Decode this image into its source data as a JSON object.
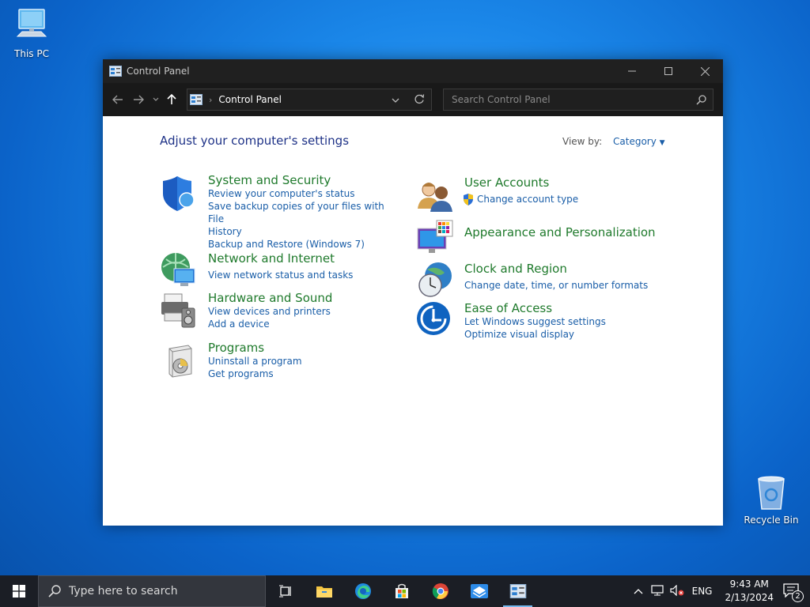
{
  "desktop": {
    "this_pc": "This PC",
    "recycle_bin": "Recycle Bin"
  },
  "window": {
    "title": "Control Panel",
    "address": "Control Panel",
    "search_placeholder": "Search Control Panel"
  },
  "content": {
    "heading": "Adjust your computer's settings",
    "view_by_label": "View by:",
    "view_by_value": "Category",
    "categories_left": [
      {
        "title": "System and Security",
        "links": [
          "Review your computer's status",
          "Save backup copies of your files with File",
          "History",
          "Backup and Restore (Windows 7)"
        ]
      },
      {
        "title": "Network and Internet",
        "links": [
          "View network status and tasks"
        ]
      },
      {
        "title": "Hardware and Sound",
        "links": [
          "View devices and printers",
          "Add a device"
        ]
      },
      {
        "title": "Programs",
        "links": [
          "Uninstall a program",
          "Get programs"
        ]
      }
    ],
    "categories_right": [
      {
        "title": "User Accounts",
        "links": [
          "Change account type"
        ]
      },
      {
        "title": "Appearance and Personalization",
        "links": []
      },
      {
        "title": "Clock and Region",
        "links": [
          "Change date, time, or number formats"
        ]
      },
      {
        "title": "Ease of Access",
        "links": [
          "Let Windows suggest settings",
          "Optimize visual display"
        ]
      }
    ]
  },
  "taskbar": {
    "search_placeholder": "Type here to search",
    "language": "ENG",
    "time": "9:43 AM",
    "date": "2/13/2024",
    "notification_count": "2"
  }
}
